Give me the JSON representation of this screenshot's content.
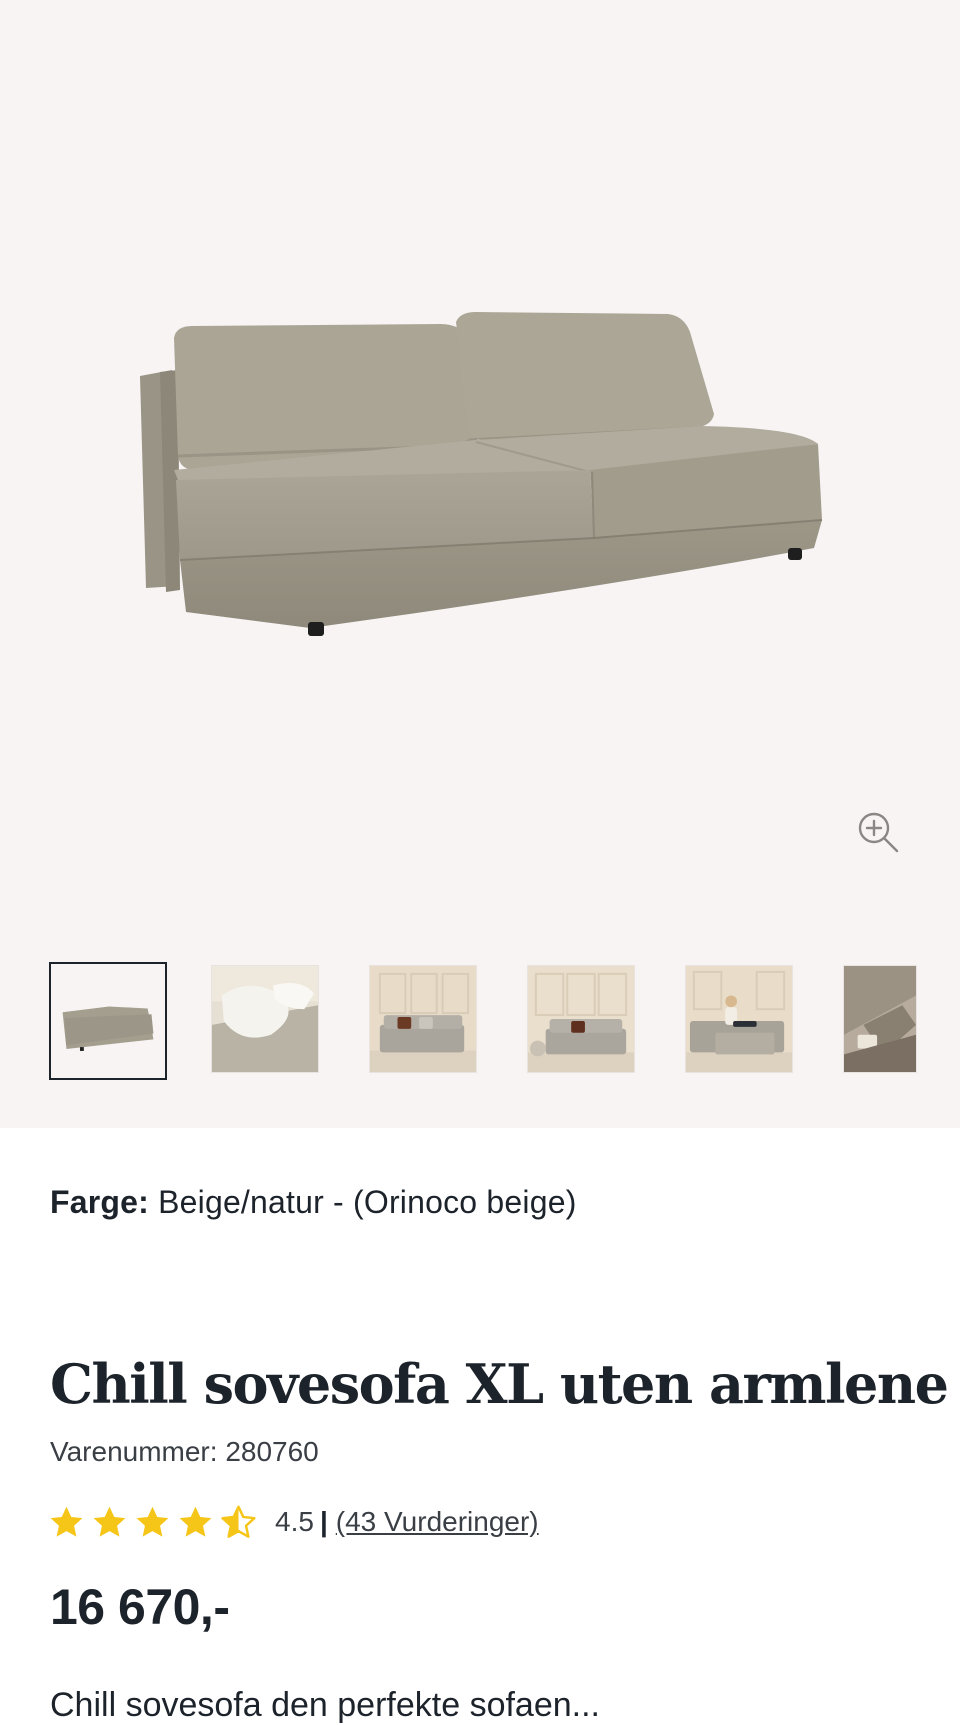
{
  "product": {
    "color_label": "Farge:",
    "color_value": "Beige/natur - (Orinoco beige)",
    "title": "Chill sovesofa XL uten armlene",
    "sku": "Varenummer: 280760",
    "rating": {
      "value": 4.5,
      "value_text": "4.5",
      "separator": "|",
      "reviews_text": "(43 Vurderinger)",
      "max": 5,
      "star_color": "#f5c518"
    },
    "price": "16 670,-",
    "description_peek": "Chill sovesofa den perfekte sofaen..."
  },
  "gallery": {
    "main_image": "beige-sofa-photo",
    "zoom_icon": "zoom-in-icon",
    "thumbnails": [
      {
        "name": "thumbnail-sofa-studio",
        "active": true
      },
      {
        "name": "thumbnail-sofa-blanket",
        "active": false
      },
      {
        "name": "thumbnail-sofa-room-1",
        "active": false
      },
      {
        "name": "thumbnail-sofa-room-2",
        "active": false
      },
      {
        "name": "thumbnail-sofa-woman",
        "active": false
      },
      {
        "name": "thumbnail-sofa-detail",
        "active": false
      }
    ]
  },
  "colors": {
    "gallery_bg": "#f7f4f3",
    "text": "#1d232b",
    "sofa": "#a49e8f"
  }
}
